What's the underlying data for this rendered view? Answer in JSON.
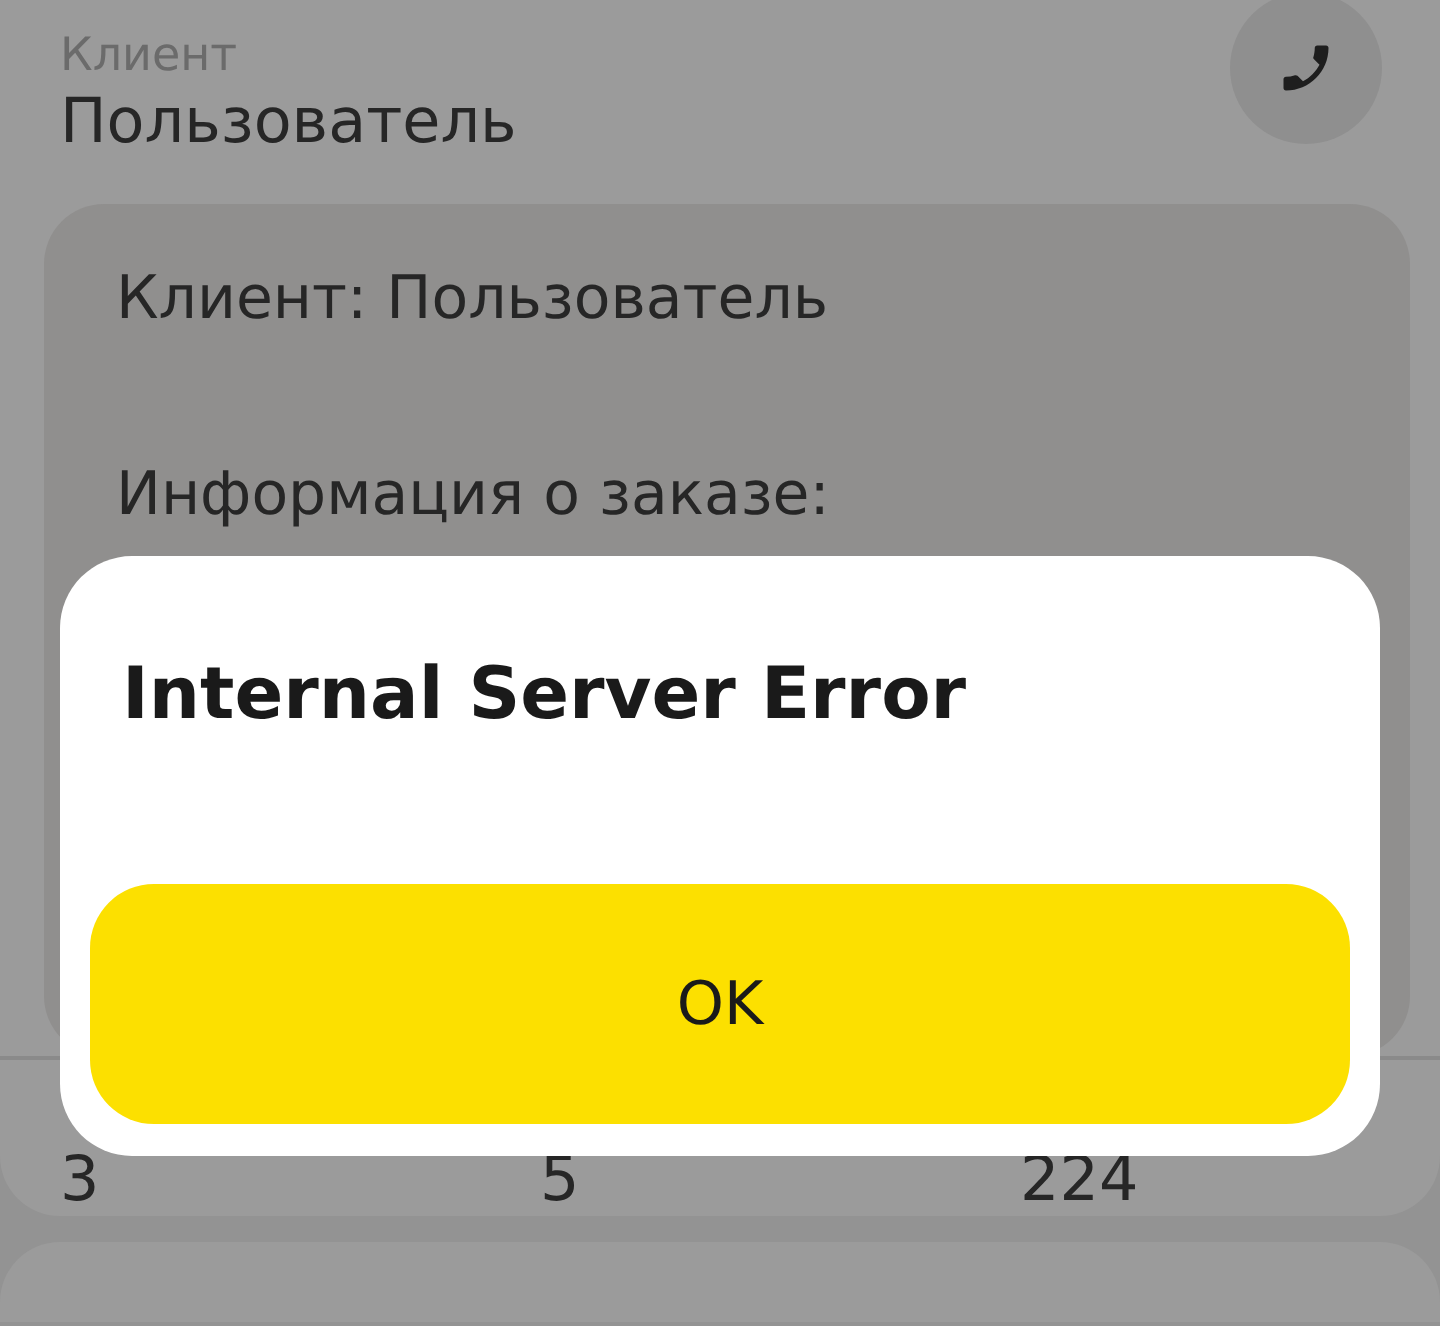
{
  "header": {
    "caption": "Клиент",
    "name": "Пользователь"
  },
  "message": {
    "lines": [
      "Клиент: Пользователь",
      "Информация о заказе:"
    ]
  },
  "details": {
    "values": [
      "3",
      "5",
      "224"
    ]
  },
  "dialog": {
    "title": "Internal Server Error",
    "button": "OK"
  }
}
